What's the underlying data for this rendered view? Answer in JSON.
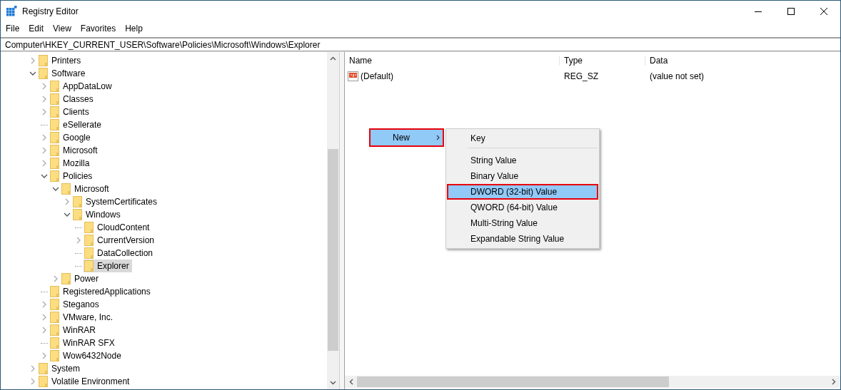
{
  "window": {
    "title": "Registry Editor"
  },
  "menu_bar": [
    "File",
    "Edit",
    "View",
    "Favorites",
    "Help"
  ],
  "address_bar": {
    "value": "Computer\\HKEY_CURRENT_USER\\Software\\Policies\\Microsoft\\Windows\\Explorer"
  },
  "tree": {
    "items": [
      {
        "label": "Printers",
        "expandable": true,
        "expanded": false,
        "selected": false
      },
      {
        "label": "Software",
        "expandable": true,
        "expanded": true,
        "selected": false,
        "children": [
          {
            "label": "AppDataLow",
            "expandable": true,
            "expanded": false,
            "selected": false
          },
          {
            "label": "Classes",
            "expandable": true,
            "expanded": false,
            "selected": false
          },
          {
            "label": "Clients",
            "expandable": true,
            "expanded": false,
            "selected": false
          },
          {
            "label": "eSellerate",
            "expandable": false,
            "selected": false
          },
          {
            "label": "Google",
            "expandable": true,
            "expanded": false,
            "selected": false
          },
          {
            "label": "Microsoft",
            "expandable": true,
            "expanded": false,
            "selected": false
          },
          {
            "label": "Mozilla",
            "expandable": true,
            "expanded": false,
            "selected": false
          },
          {
            "label": "Policies",
            "expandable": true,
            "expanded": true,
            "selected": false,
            "children": [
              {
                "label": "Microsoft",
                "expandable": true,
                "expanded": true,
                "selected": false,
                "children": [
                  {
                    "label": "SystemCertificates",
                    "expandable": true,
                    "expanded": false,
                    "selected": false
                  },
                  {
                    "label": "Windows",
                    "expandable": true,
                    "expanded": true,
                    "selected": false,
                    "children": [
                      {
                        "label": "CloudContent",
                        "expandable": false,
                        "selected": false
                      },
                      {
                        "label": "CurrentVersion",
                        "expandable": true,
                        "expanded": false,
                        "selected": false
                      },
                      {
                        "label": "DataCollection",
                        "expandable": false,
                        "selected": false
                      },
                      {
                        "label": "Explorer",
                        "expandable": false,
                        "selected": true
                      }
                    ]
                  }
                ]
              },
              {
                "label": "Power",
                "expandable": true,
                "expanded": false,
                "selected": false
              }
            ]
          },
          {
            "label": "RegisteredApplications",
            "expandable": false,
            "selected": false
          },
          {
            "label": "Steganos",
            "expandable": true,
            "expanded": false,
            "selected": false
          },
          {
            "label": "VMware, Inc.",
            "expandable": true,
            "expanded": false,
            "selected": false
          },
          {
            "label": "WinRAR",
            "expandable": true,
            "expanded": false,
            "selected": false
          },
          {
            "label": "WinRAR SFX",
            "expandable": false,
            "selected": false
          },
          {
            "label": "Wow6432Node",
            "expandable": true,
            "expanded": false,
            "selected": false
          }
        ]
      },
      {
        "label": "System",
        "expandable": true,
        "expanded": false,
        "selected": false
      },
      {
        "label": "Volatile Environment",
        "expandable": true,
        "expanded": false,
        "selected": false
      }
    ]
  },
  "values_table": {
    "columns": [
      "Name",
      "Type",
      "Data"
    ],
    "rows": [
      {
        "name": "(Default)",
        "type": "REG_SZ",
        "data": "(value not set)"
      }
    ]
  },
  "context_menu": {
    "items": [
      {
        "label": "New",
        "selected": true,
        "outlined": true
      }
    ]
  },
  "submenu": {
    "items": [
      {
        "kind": "item",
        "label": "Key",
        "selected": false,
        "outlined": false
      },
      {
        "kind": "separator"
      },
      {
        "kind": "item",
        "label": "String Value",
        "selected": false,
        "outlined": false
      },
      {
        "kind": "item",
        "label": "Binary Value",
        "selected": false,
        "outlined": false
      },
      {
        "kind": "item",
        "label": "DWORD (32-bit) Value",
        "selected": true,
        "outlined": true
      },
      {
        "kind": "item",
        "label": "QWORD (64-bit) Value",
        "selected": false,
        "outlined": false
      },
      {
        "kind": "item",
        "label": "Multi-String Value",
        "selected": false,
        "outlined": false
      },
      {
        "kind": "item",
        "label": "Expandable String Value",
        "selected": false,
        "outlined": false
      }
    ]
  }
}
